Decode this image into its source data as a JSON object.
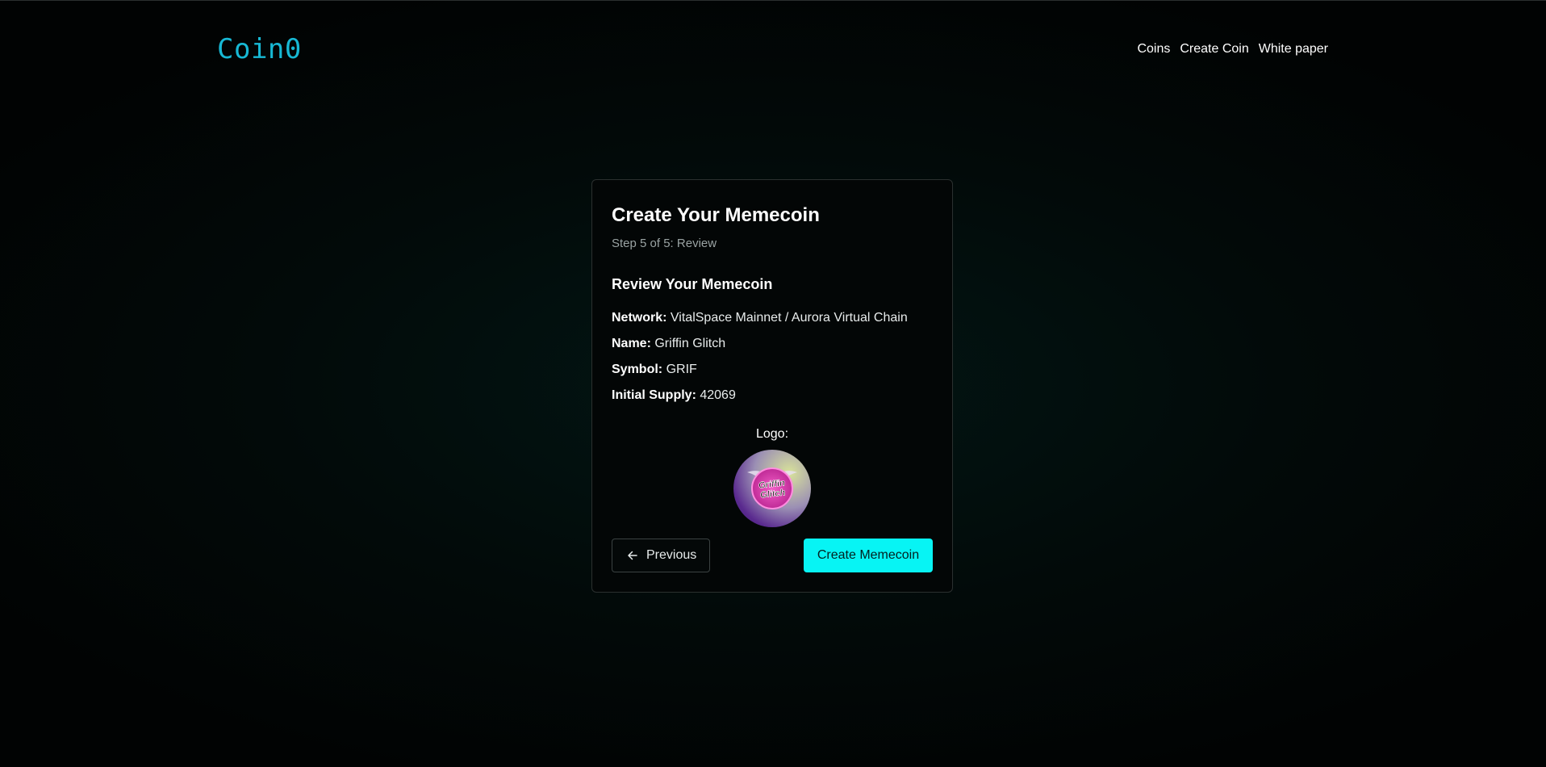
{
  "header": {
    "brand": "Coin0",
    "nav": [
      {
        "label": "Coins"
      },
      {
        "label": "Create Coin"
      },
      {
        "label": "White paper"
      }
    ]
  },
  "card": {
    "title": "Create Your Memecoin",
    "subtitle": "Step 5 of 5: Review",
    "section_title": "Review Your Memecoin",
    "details": {
      "network": {
        "label": "Network:",
        "value": "VitalSpace Mainnet / Aurora Virtual Chain"
      },
      "name": {
        "label": "Name:",
        "value": "Griffin Glitch"
      },
      "symbol": {
        "label": "Symbol:",
        "value": "GRIF"
      },
      "supply": {
        "label": "Initial Supply:",
        "value": "42069"
      }
    },
    "logo_label": "Logo:",
    "logo_text": "Griffin Glitch",
    "buttons": {
      "previous": "Previous",
      "create": "Create Memecoin"
    }
  },
  "colors": {
    "brand": "#17b8d4",
    "accent": "#07f4f4",
    "background": "#020a09"
  },
  "icons": {
    "previous": "arrow-left-icon"
  }
}
